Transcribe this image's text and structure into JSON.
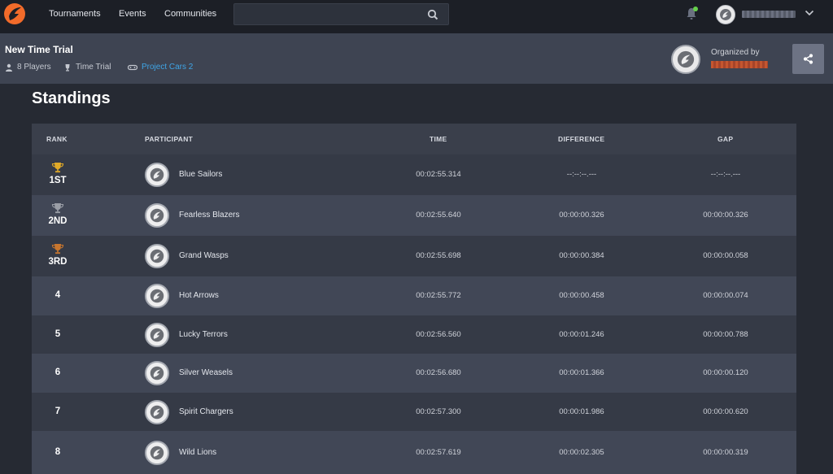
{
  "nav": {
    "links": [
      "Tournaments",
      "Events",
      "Communities"
    ],
    "search_placeholder": "",
    "username": "xxxxxxxxxx"
  },
  "header": {
    "title": "New Time Trial",
    "players": "8 Players",
    "format": "Time Trial",
    "game": "Project Cars 2",
    "organized_by_label": "Organized by",
    "organizer_name": "xxxxxxxxxxx"
  },
  "standings": {
    "title": "Standings",
    "columns": [
      "RANK",
      "PARTICIPANT",
      "TIME",
      "DIFFERENCE",
      "GAP"
    ],
    "rows": [
      {
        "rank": "1ST",
        "trophy": "gold",
        "name": "Blue Sailors",
        "time": "00:02:55.314",
        "difference": "--:--:--.---",
        "gap": "--:--:--.---"
      },
      {
        "rank": "2ND",
        "trophy": "silver",
        "name": "Fearless Blazers",
        "time": "00:02:55.640",
        "difference": "00:00:00.326",
        "gap": "00:00:00.326"
      },
      {
        "rank": "3RD",
        "trophy": "bronze",
        "name": "Grand Wasps",
        "time": "00:02:55.698",
        "difference": "00:00:00.384",
        "gap": "00:00:00.058"
      },
      {
        "rank": "4",
        "trophy": "",
        "name": "Hot Arrows",
        "time": "00:02:55.772",
        "difference": "00:00:00.458",
        "gap": "00:00:00.074"
      },
      {
        "rank": "5",
        "trophy": "",
        "name": "Lucky Terrors",
        "time": "00:02:56.560",
        "difference": "00:00:01.246",
        "gap": "00:00:00.788"
      },
      {
        "rank": "6",
        "trophy": "",
        "name": "Silver Weasels",
        "time": "00:02:56.680",
        "difference": "00:00:01.366",
        "gap": "00:00:00.120"
      },
      {
        "rank": "7",
        "trophy": "",
        "name": "Spirit Chargers",
        "time": "00:02:57.300",
        "difference": "00:00:01.986",
        "gap": "00:00:00.620"
      },
      {
        "rank": "8",
        "trophy": "",
        "name": "Wild Lions",
        "time": "00:02:57.619",
        "difference": "00:00:02.305",
        "gap": "00:00:00.319"
      }
    ]
  },
  "colors": {
    "accent": "#f26b2a",
    "link": "#3fa5e6",
    "gold": "#e0a928",
    "silver": "#9a9ea6",
    "bronze": "#c8762e"
  }
}
